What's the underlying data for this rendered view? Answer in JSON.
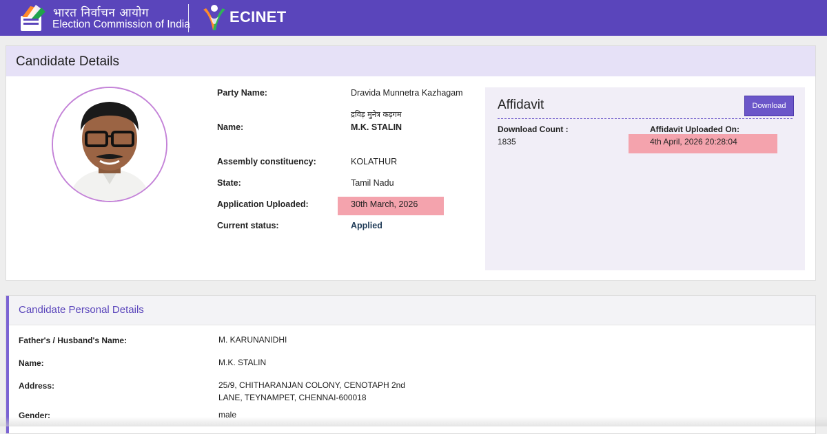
{
  "header": {
    "org_hindi": "भारत निर्वाचन आयोग",
    "org_english": "Election Commission of India",
    "product": "ECINET"
  },
  "candidate_card": {
    "title": "Candidate Details",
    "fields": {
      "party_label": "Party Name:",
      "party_value": "Dravida Munnetra Kazhagam",
      "name_hindi": "द्रविड़ मुनेत्र कड़गम",
      "name_label": "Name:",
      "name_value": "M.K. STALIN",
      "constituency_label": "Assembly constituency:",
      "constituency_value": "KOLATHUR",
      "state_label": "State:",
      "state_value": "Tamil Nadu",
      "uploaded_label": "Application Uploaded:",
      "uploaded_value": "30th March, 2026",
      "status_label": "Current status:",
      "status_value": "Applied"
    },
    "affidavit": {
      "title": "Affidavit",
      "download_label": "Download",
      "count_label": "Download Count :",
      "count_value": "1835",
      "uploaded_on_label": "Affidavit Uploaded On:",
      "uploaded_on_value": "4th April, 2026 20:28:04"
    }
  },
  "personal_card": {
    "title": "Candidate Personal Details",
    "father_label": "Father's / Husband's Name:",
    "father_value": "M. KARUNANIDHI",
    "name_label": "Name:",
    "name_value": "M.K. STALIN",
    "address_label": "Address:",
    "address_line1": "25/9, CHITHARANJAN COLONY, CENOTAPH 2nd",
    "address_line2": "LANE, TEYNAMPET, CHENNAI-600018",
    "gender_label": "Gender:",
    "gender_value": "male"
  },
  "colors": {
    "header_bg": "#5a45bb",
    "accent": "#6b56c9",
    "highlight": "#f4a3ad",
    "status_text": "#1f3b57"
  },
  "icons": [
    "eci-ballot-logo-icon",
    "ecinet-logo-icon",
    "candidate-photo"
  ]
}
